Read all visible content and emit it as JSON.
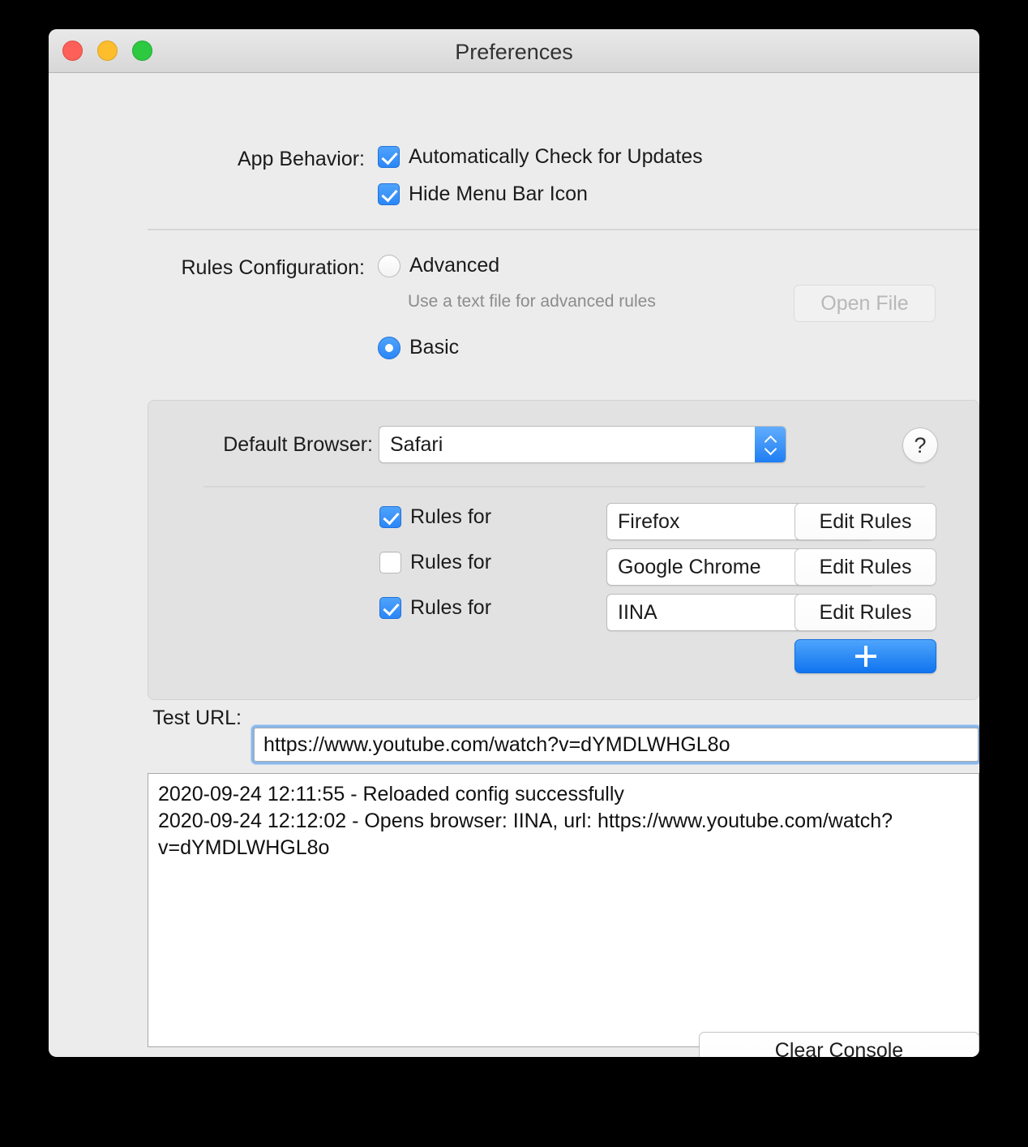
{
  "window": {
    "title": "Preferences",
    "traffic_lights": [
      {
        "name": "close-button",
        "color": "#fc6058"
      },
      {
        "name": "minimize-button",
        "color": "#fdbd2d"
      },
      {
        "name": "maximize-button",
        "color": "#2cc941"
      }
    ]
  },
  "app_behavior": {
    "label": "App Behavior:",
    "options": [
      {
        "label": "Automatically Check for Updates",
        "checked": true
      },
      {
        "label": "Hide Menu Bar Icon",
        "checked": true
      }
    ]
  },
  "rules_configuration": {
    "label": "Rules Configuration:",
    "advanced": {
      "label": "Advanced",
      "selected": false,
      "hint": "Use a text file for advanced rules",
      "open_file_button": "Open File",
      "open_file_enabled": false
    },
    "basic": {
      "label": "Basic",
      "selected": true
    }
  },
  "basic_group": {
    "default_browser": {
      "label": "Default Browser:",
      "value": "Safari"
    },
    "help_button": "?",
    "rules": [
      {
        "checked": true,
        "label": "Rules for",
        "browser": "Firefox",
        "edit_button": "Edit Rules"
      },
      {
        "checked": false,
        "label": "Rules for",
        "browser": "Google Chrome",
        "edit_button": "Edit Rules"
      },
      {
        "checked": true,
        "label": "Rules for",
        "browser": "IINA",
        "edit_button": "Edit Rules"
      }
    ],
    "add_button": "+"
  },
  "test_url": {
    "label": "Test URL:",
    "value": "https://www.youtube.com/watch?v=dYMDLWHGL8o",
    "focused": true
  },
  "console": {
    "lines": [
      "2020-09-24 12:11:55 - Reloaded config successfully",
      "2020-09-24 12:12:02 - Opens browser: IINA, url: https://www.youtube.com/watch?v=dYMDLWHGL8o"
    ],
    "clear_button": "Clear Console"
  },
  "colors": {
    "accent": "#2b86f7",
    "window_bg": "#ececec",
    "group_bg": "#e2e2e2",
    "focus_ring": "#88b8ec"
  }
}
